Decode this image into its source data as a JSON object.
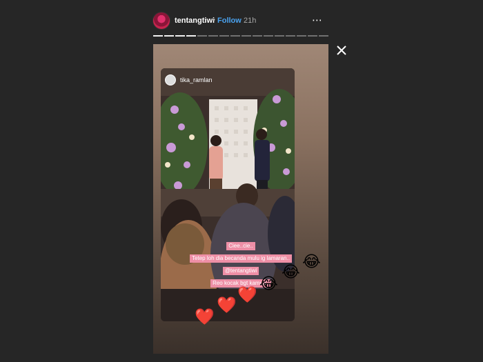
{
  "header": {
    "username": "tentangtiwi",
    "separator": "•",
    "follow_label": "Follow",
    "timestamp": "21h",
    "more_icon": "⋯"
  },
  "progress": {
    "total": 16,
    "viewed": 4
  },
  "close_icon": "close-icon",
  "story": {
    "inner_username": "tika_ramlan",
    "captions": [
      "Ciee..cie..",
      "Tetep loh dia becanda mulu ig lamaran..",
      "@tentangtiwi",
      "Reo kocak bgt kamuu.."
    ],
    "stickers": {
      "laughing": [
        "😂",
        "😂",
        "😂"
      ],
      "hearts": [
        "❤️",
        "❤️",
        "❤️"
      ]
    }
  }
}
